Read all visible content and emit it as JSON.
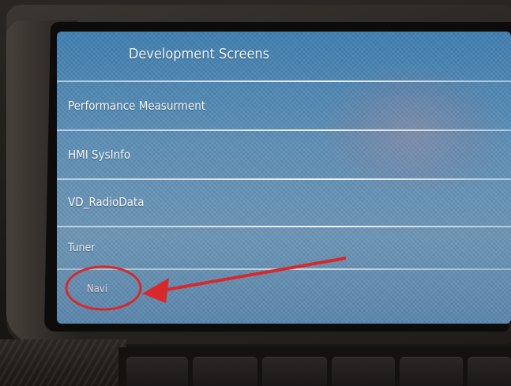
{
  "screen": {
    "title": "Development Screens",
    "menu_items": [
      "Performance Measurment",
      "HMI SysInfo",
      "VD_RadioData",
      "Tuner",
      "Navi"
    ]
  },
  "annotation": {
    "highlighted_item": "Navi",
    "color": "#d8282a"
  },
  "colors": {
    "screen_bg": "#5e8fb6",
    "text": "#f4f7fa",
    "bezel": "#2a2622"
  }
}
